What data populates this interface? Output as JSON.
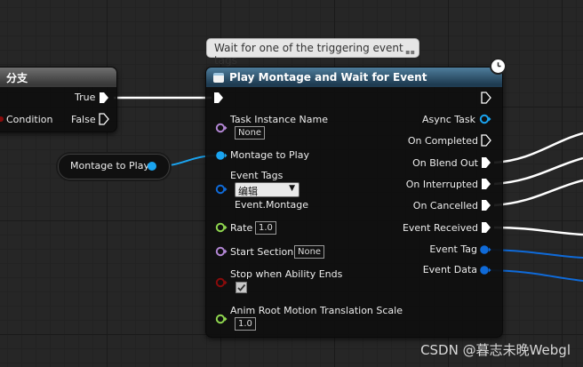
{
  "tooltip": "Wait for one of the triggering event tags",
  "branch_node": {
    "title": "分支",
    "true_label": "True",
    "false_label": "False",
    "condition_label": "Condition"
  },
  "variable_node": {
    "label": "Montage to Play"
  },
  "main_node": {
    "title": "Play Montage and Wait for Event",
    "inputs": {
      "task_instance_name": "Task Instance Name",
      "task_instance_value": "None",
      "montage_to_play": "Montage to Play",
      "event_tags": "Event Tags",
      "event_tags_dropdown": "编辑",
      "event_tags_value": "Event.Montage",
      "rate": "Rate",
      "rate_value": "1.0",
      "start_section": "Start Section",
      "start_section_value": "None",
      "stop_when_ability_ends": "Stop when Ability Ends",
      "anim_root_motion": "Anim Root Motion Translation Scale",
      "anim_root_motion_value": "1.0"
    },
    "outputs": {
      "async_task": "Async Task",
      "on_completed": "On Completed",
      "on_blend_out": "On Blend Out",
      "on_interrupted": "On Interrupted",
      "on_cancelled": "On Cancelled",
      "event_received": "Event Received",
      "event_tag": "Event Tag",
      "event_data": "Event Data"
    },
    "stop_checked": true
  },
  "watermark": "CSDN @暮志未晚Webgl",
  "colors": {
    "exec": "#ffffff",
    "object_pin": "#b286d4",
    "montage_pin": "#1aa4f0",
    "struct_pin": "#0f6ad8",
    "float_pin": "#8fd64f",
    "bool_pin": "#8a0b0b",
    "header_top": "#4e7d9c"
  }
}
